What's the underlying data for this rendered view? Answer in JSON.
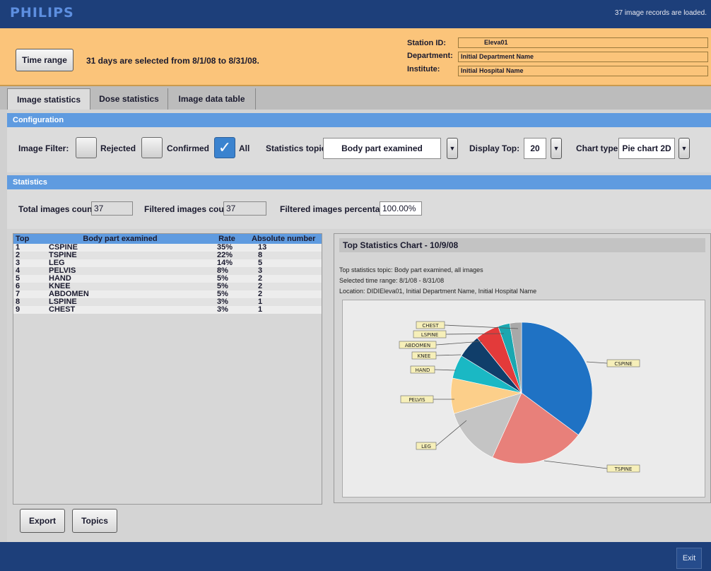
{
  "header": {
    "logo": "PHILIPS",
    "status": "37 image records are loaded."
  },
  "time_range": {
    "button": "Time range",
    "text": "31 days are selected from 8/1/08 to 8/31/08."
  },
  "station": {
    "station_label": "Station ID:",
    "station_value": "Eleva01",
    "department_label": "Department:",
    "department_value": "Initial Department Name",
    "institute_label": "Institute:",
    "institute_value": "Initial Hospital Name"
  },
  "tabs": [
    "Image statistics",
    "Dose statistics",
    "Image data table"
  ],
  "configuration": {
    "title": "Configuration",
    "filter_label": "Image Filter:",
    "rejected": "Rejected",
    "confirmed": "Confirmed",
    "all": "All",
    "topic_label": "Statistics topic:",
    "topic_value": "Body part examined",
    "display_label": "Display Top:",
    "display_value": "20",
    "charttype_label": "Chart type:",
    "charttype_value": "Pie chart 2D"
  },
  "statistics": {
    "title": "Statistics",
    "total_label": "Total images count:",
    "total_value": "37",
    "filtered_label": "Filtered images count:",
    "filtered_value": "37",
    "pct_label": "Filtered images percentage:",
    "pct_value": "100.00%"
  },
  "table": {
    "headers": [
      "Top",
      "Body part examined",
      "Rate",
      "Absolute number"
    ],
    "rows": [
      [
        "1",
        "CSPINE",
        "35%",
        "13"
      ],
      [
        "2",
        "TSPINE",
        "22%",
        "8"
      ],
      [
        "3",
        "LEG",
        "14%",
        "5"
      ],
      [
        "4",
        "PELVIS",
        "8%",
        "3"
      ],
      [
        "5",
        "HAND",
        "5%",
        "2"
      ],
      [
        "6",
        "KNEE",
        "5%",
        "2"
      ],
      [
        "7",
        "ABDOMEN",
        "5%",
        "2"
      ],
      [
        "8",
        "LSPINE",
        "3%",
        "1"
      ],
      [
        "9",
        "CHEST",
        "3%",
        "1"
      ]
    ]
  },
  "chart_panel": {
    "title": "Top Statistics Chart - 10/9/08",
    "line1": "Top statistics topic:  Body part examined, all images",
    "line2": "Selected time range:  8/1/08 - 8/31/08",
    "line3": "Location:  DIDIEleva01, Initial Department Name, Initial Hospital Name"
  },
  "chart_data": {
    "type": "pie",
    "categories": [
      "CSPINE",
      "TSPINE",
      "LEG",
      "PELVIS",
      "HAND",
      "KNEE",
      "ABDOMEN",
      "LSPINE",
      "CHEST"
    ],
    "values": [
      13,
      8,
      5,
      3,
      2,
      2,
      2,
      1,
      1
    ],
    "colors": [
      "#1f72c4",
      "#e8807a",
      "#c4c4c4",
      "#fccf8a",
      "#1ab8c4",
      "#103e6a",
      "#e33a3a",
      "#1aa7b0",
      "#a8a8a8"
    ],
    "legend": "callout labels"
  },
  "bottom": {
    "export": "Export",
    "topics": "Topics",
    "exit": "Exit"
  }
}
